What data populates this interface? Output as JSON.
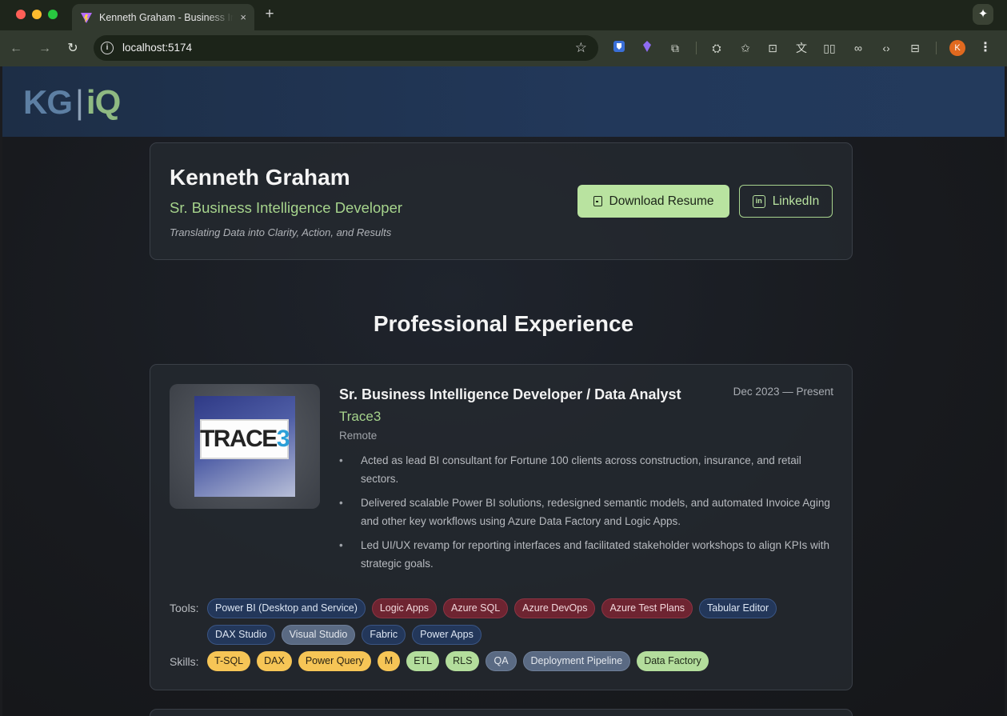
{
  "browser": {
    "tab_title": "Kenneth Graham - Business Intelligence Developer",
    "tab_close": "×",
    "new_tab": "+",
    "url": "localhost:5174",
    "avatar_letter": "K"
  },
  "header": {
    "logo_left": "KG",
    "logo_separator": "|",
    "logo_right": "iQ"
  },
  "hero": {
    "name": "Kenneth Graham",
    "title": "Sr. Business Intelligence Developer",
    "tagline": "Translating Data into Clarity, Action, and Results",
    "download_label": "Download Resume",
    "linkedin_label": "LinkedIn"
  },
  "experience": {
    "section_title": "Professional Experience",
    "jobs": [
      {
        "title": "Sr. Business Intelligence Developer / Data Analyst",
        "dates": "Dec 2023 — Present",
        "company": "Trace3",
        "location": "Remote",
        "logo_text_main": "TRACE",
        "logo_text_accent": "3",
        "bullets": [
          "Acted as lead BI consultant for Fortune 100 clients across construction, insurance, and retail sectors.",
          "Delivered scalable Power BI solutions, redesigned semantic models, and automated Invoice Aging and other key workflows using Azure Data Factory and Logic Apps.",
          "Led UI/UX revamp for reporting interfaces and facilitated stakeholder workshops to align KPIs with strategic goals."
        ],
        "tools_label": "Tools:",
        "tools": [
          {
            "label": "Power BI (Desktop and Service)",
            "style": "blue"
          },
          {
            "label": "Logic Apps",
            "style": "red"
          },
          {
            "label": "Azure SQL",
            "style": "red"
          },
          {
            "label": "Azure DevOps",
            "style": "red"
          },
          {
            "label": "Azure Test Plans",
            "style": "red"
          },
          {
            "label": "Tabular Editor",
            "style": "blue"
          },
          {
            "label": "DAX Studio",
            "style": "blue"
          },
          {
            "label": "Visual Studio",
            "style": "slate"
          },
          {
            "label": "Fabric",
            "style": "blue"
          },
          {
            "label": "Power Apps",
            "style": "blue"
          }
        ],
        "skills_label": "Skills:",
        "skills": [
          {
            "label": "T-SQL",
            "style": "yellow"
          },
          {
            "label": "DAX",
            "style": "yellow"
          },
          {
            "label": "Power Query",
            "style": "yellow"
          },
          {
            "label": "M",
            "style": "yellow"
          },
          {
            "label": "ETL",
            "style": "green"
          },
          {
            "label": "RLS",
            "style": "green"
          },
          {
            "label": "QA",
            "style": "slate"
          },
          {
            "label": "Deployment Pipeline",
            "style": "slate"
          },
          {
            "label": "Data Factory",
            "style": "green"
          }
        ]
      }
    ]
  },
  "colors": {
    "accent_green": "#a6d48c",
    "button_green": "#b9e3a0",
    "header_blue": "#22385a"
  }
}
